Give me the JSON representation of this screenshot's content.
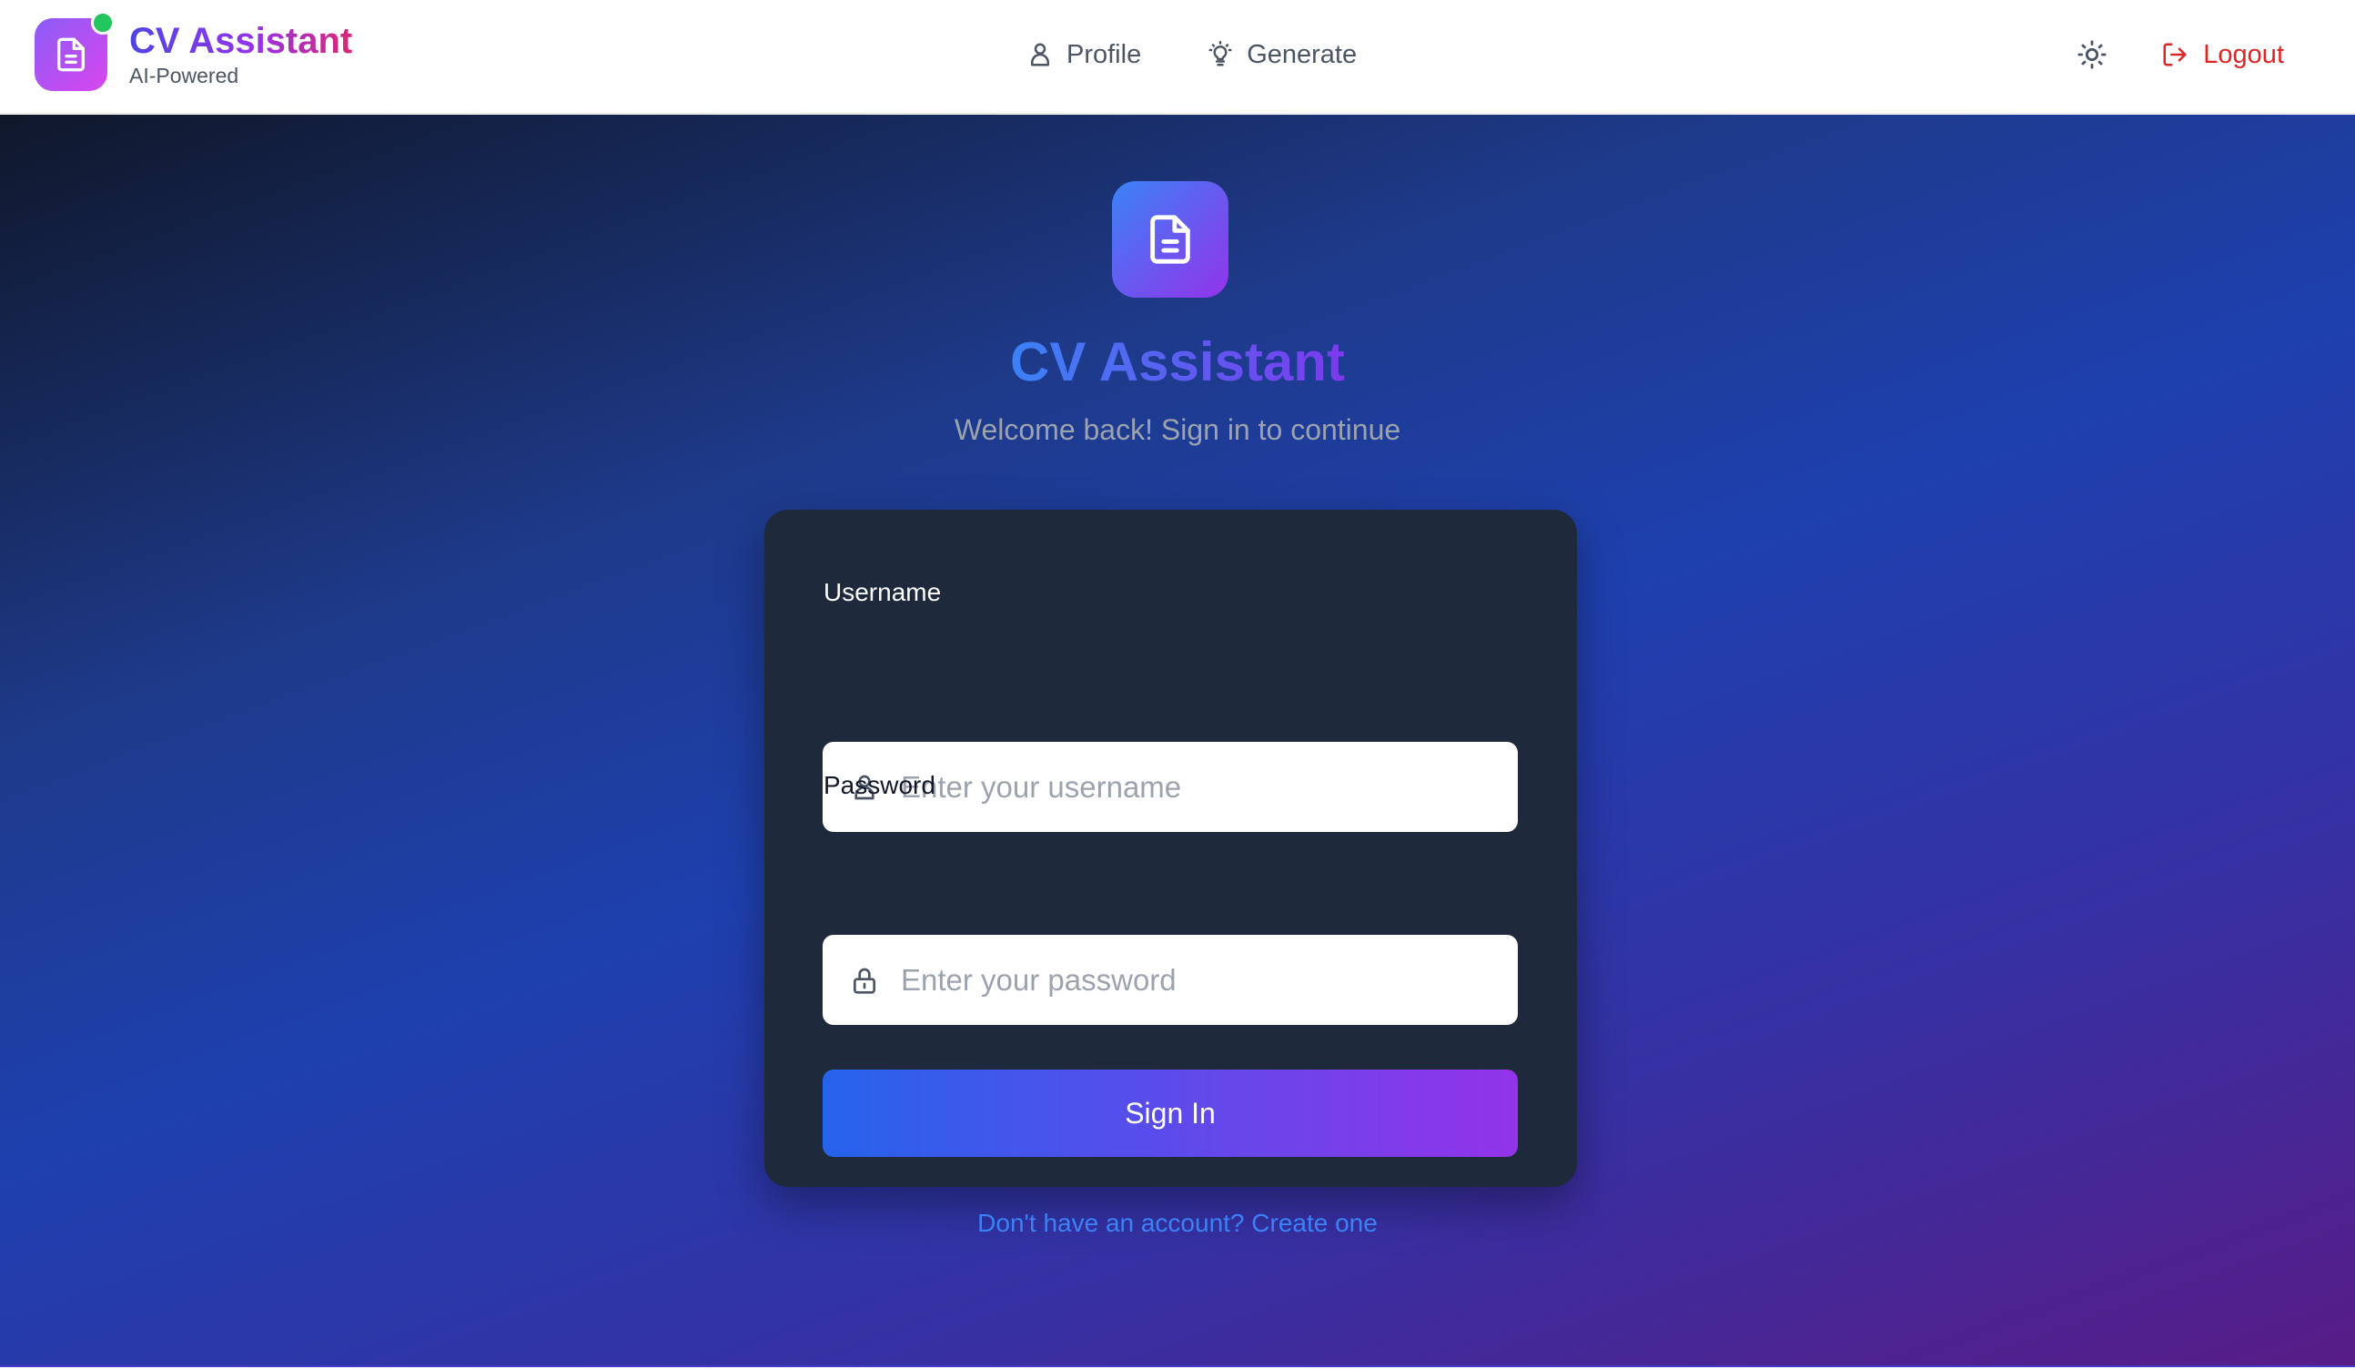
{
  "brand": {
    "title": "CV Assistant",
    "subtitle": "AI-Powered",
    "logo_icon": "document-icon",
    "status_color": "#22c55e"
  },
  "nav": {
    "items": [
      {
        "label": "Profile",
        "icon": "user-icon"
      },
      {
        "label": "Generate",
        "icon": "lightbulb-icon"
      }
    ],
    "theme_toggle_icon": "sun-icon",
    "logout": {
      "label": "Logout",
      "icon": "logout-icon",
      "color": "#dc2626"
    }
  },
  "hero": {
    "icon": "document-icon",
    "title": "CV Assistant",
    "subtitle": "Welcome back! Sign in to continue"
  },
  "form": {
    "username": {
      "label": "Username",
      "placeholder": "Enter your username",
      "value": "",
      "icon": "user-icon"
    },
    "password": {
      "label": "Password",
      "placeholder": "Enter your password",
      "value": "",
      "icon": "lock-icon"
    },
    "submit_label": "Sign In",
    "signup_link": "Don't have an account? Create one"
  },
  "colors": {
    "accent_blue": "#2563eb",
    "accent_purple": "#9333ea",
    "card_bg": "#1e293b"
  }
}
